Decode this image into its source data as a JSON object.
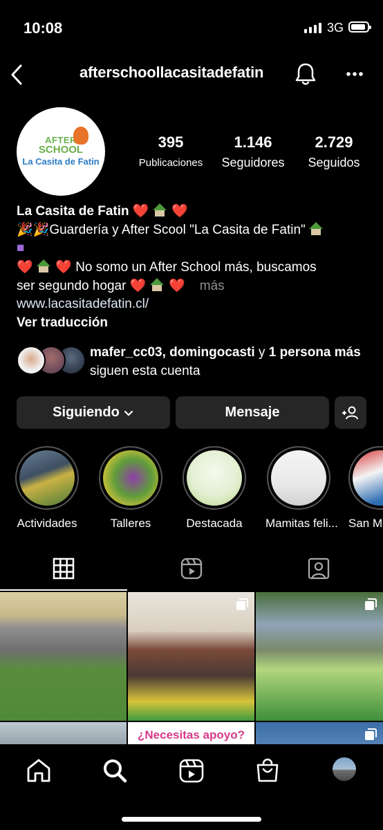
{
  "status_bar": {
    "time": "10:08",
    "network": "3G"
  },
  "header": {
    "username": "afterschoollacasitadefatin"
  },
  "profile": {
    "logo": {
      "line1": "AFTER",
      "line2": "SCHOOL",
      "line3": "La Casita de Fatin"
    },
    "stats": [
      {
        "value": "395",
        "label": "Publicaciones"
      },
      {
        "value": "1.146",
        "label": "Seguidores"
      },
      {
        "value": "2.729",
        "label": "Seguidos"
      }
    ],
    "name": "La Casita de Fatin",
    "bio_line1": "Guardería y After Scool \"La Casita de Fatin\"",
    "bio_line2": "No somo un After School más, buscamos",
    "bio_line3": "ser segundo hogar",
    "more_label": "más",
    "website": "www.lacasitadefatin.cl/",
    "translate_label": "Ver traducción"
  },
  "followed_by": {
    "user1": "mafer_cc03",
    "separator": ", ",
    "user2": "domingocasti",
    "and_word": " y ",
    "others": "1 persona más",
    "suffix": " siguen esta cuenta"
  },
  "actions": {
    "following_label": "Siguiendo",
    "message_label": "Mensaje"
  },
  "highlights": [
    {
      "label": "Actividades"
    },
    {
      "label": "Talleres"
    },
    {
      "label": "Destacada"
    },
    {
      "label": "Mamitas feli..."
    },
    {
      "label": "San M"
    }
  ],
  "grid_posts": [
    {
      "text": ""
    },
    {
      "text": ""
    },
    {
      "text": ""
    },
    {
      "text": ""
    },
    {
      "text": "¿Necesitas apoyo?"
    },
    {
      "text": ""
    }
  ],
  "bottom_nav": [
    "home-icon",
    "search-icon",
    "reels-icon",
    "shop-icon",
    "profile-avatar"
  ]
}
